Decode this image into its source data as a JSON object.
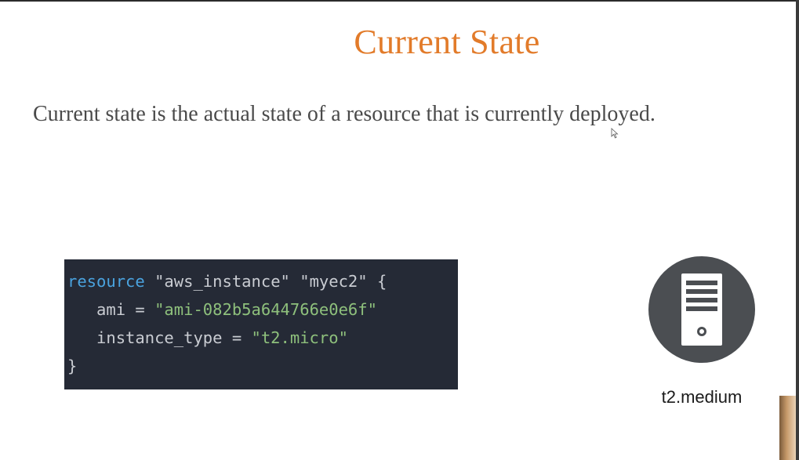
{
  "slide": {
    "title": "Current State",
    "description": "Current state is the actual state of a resource that is currently deployed."
  },
  "code": {
    "line1": {
      "keyword": "resource",
      "rest": " \"aws_instance\" \"myec2\" {"
    },
    "line2": {
      "prefix": "   ami = ",
      "value": "\"ami-082b5a644766e0e6f\""
    },
    "line3": {
      "prefix": "   instance_type = ",
      "value": "\"t2.micro\""
    },
    "line4": "}"
  },
  "instance": {
    "label": "t2.medium",
    "icon": "server-icon"
  },
  "colors": {
    "title": "#e27b2a",
    "code_bg": "#252a36",
    "keyword": "#4aa3df",
    "string_value": "#8ec07c",
    "icon_circle": "#4b4e52"
  }
}
